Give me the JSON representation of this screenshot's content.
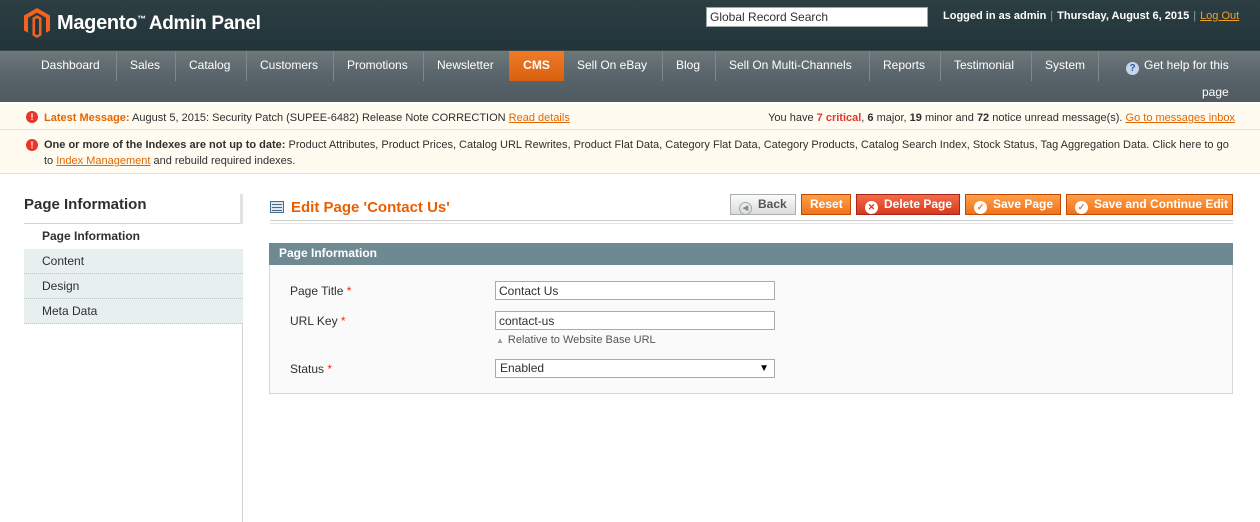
{
  "header": {
    "brand": "Magento",
    "brand_tm": "™",
    "brand_sub": "Admin Panel",
    "search_value": "Global Record Search",
    "logged_in": "Logged in as admin",
    "date": "Thursday, August 6, 2015",
    "logout": "Log Out"
  },
  "nav": {
    "items": [
      "Dashboard",
      "Sales",
      "Catalog",
      "Customers",
      "Promotions",
      "Newsletter",
      "CMS",
      "Sell On eBay",
      "Blog",
      "Sell On Multi-Channels",
      "Reports",
      "Testimonial",
      "System"
    ],
    "active": "CMS",
    "help_line1": "Get help for this",
    "help_line2": "page"
  },
  "messages": {
    "latest_label": "Latest Message:",
    "latest_text": "August 5, 2015: Security Patch (SUPEE-6482) Release Note CORRECTION",
    "read_details": "Read details",
    "summary_prefix": "You have",
    "critical_count": "7 critical",
    "major": "6",
    "major_label": "major,",
    "minor": "19",
    "minor_label": "minor and",
    "notice": "72",
    "notice_label": "notice unread message(s).",
    "goto_inbox": "Go to messages inbox",
    "index_bold": "One or more of the Indexes are not up to date:",
    "index_text": "Product Attributes, Product Prices, Catalog URL Rewrites, Product Flat Data, Category Flat Data, Category Products, Catalog Search Index, Stock Status, Tag Aggregation Data. Click here to go to",
    "index_link": "Index Management",
    "index_tail": "and rebuild required indexes."
  },
  "sidebar": {
    "title": "Page Information",
    "tabs": [
      "Page Information",
      "Content",
      "Design",
      "Meta Data"
    ]
  },
  "main": {
    "title": "Edit Page 'Contact Us'",
    "buttons": {
      "back": "Back",
      "reset": "Reset",
      "delete": "Delete Page",
      "save": "Save Page",
      "save_continue": "Save and Continue Edit"
    },
    "fieldset_title": "Page Information",
    "fields": {
      "page_title_label": "Page Title",
      "page_title_value": "Contact Us",
      "url_key_label": "URL Key",
      "url_key_value": "contact-us",
      "url_note": "Relative to Website Base URL",
      "status_label": "Status",
      "status_value": "Enabled",
      "required_mark": "*"
    }
  }
}
